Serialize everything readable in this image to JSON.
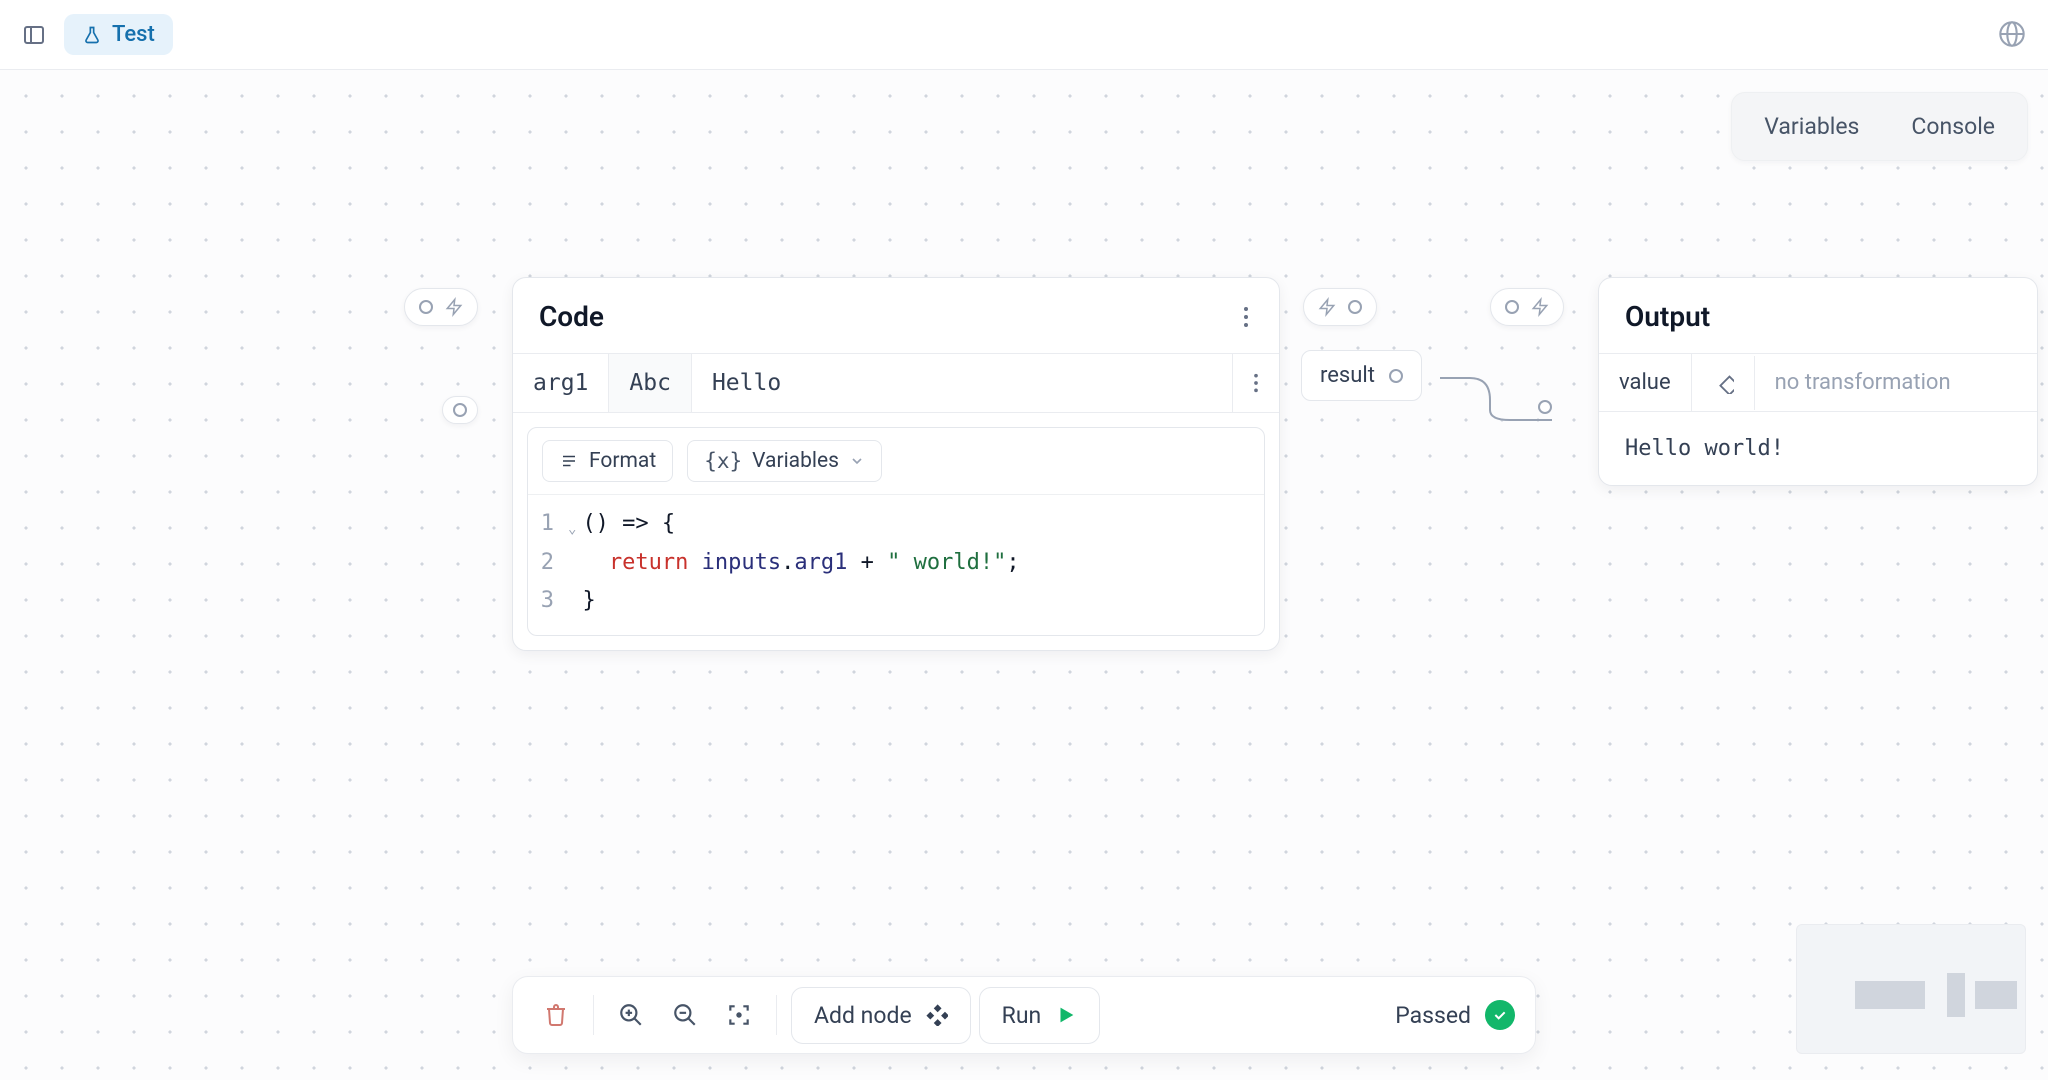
{
  "topbar": {
    "tab_label": "Test"
  },
  "view_switch": {
    "variables": "Variables",
    "console": "Console"
  },
  "code_node": {
    "title": "Code",
    "input": {
      "arg_name": "arg1",
      "type_badge": "Abc",
      "value": "Hello"
    },
    "toolbar": {
      "format": "Format",
      "variables": "Variables"
    },
    "lines": {
      "l1_num": "1",
      "l1_text": "() => {",
      "l2_num": "2",
      "l2_kw": "return",
      "l2_id": " inputs",
      "l2_dot": ".",
      "l2_prop": "arg1",
      "l2_plus": " + ",
      "l2_str": "\" world!\"",
      "l2_semi": ";",
      "l3_num": "3",
      "l3_text": "}"
    }
  },
  "connector": {
    "result_label": "result"
  },
  "output_node": {
    "title": "Output",
    "value_label": "value",
    "transform_placeholder": "no transformation",
    "body": "Hello world!"
  },
  "bottom": {
    "add_node": "Add node",
    "run": "Run",
    "status": "Passed"
  }
}
